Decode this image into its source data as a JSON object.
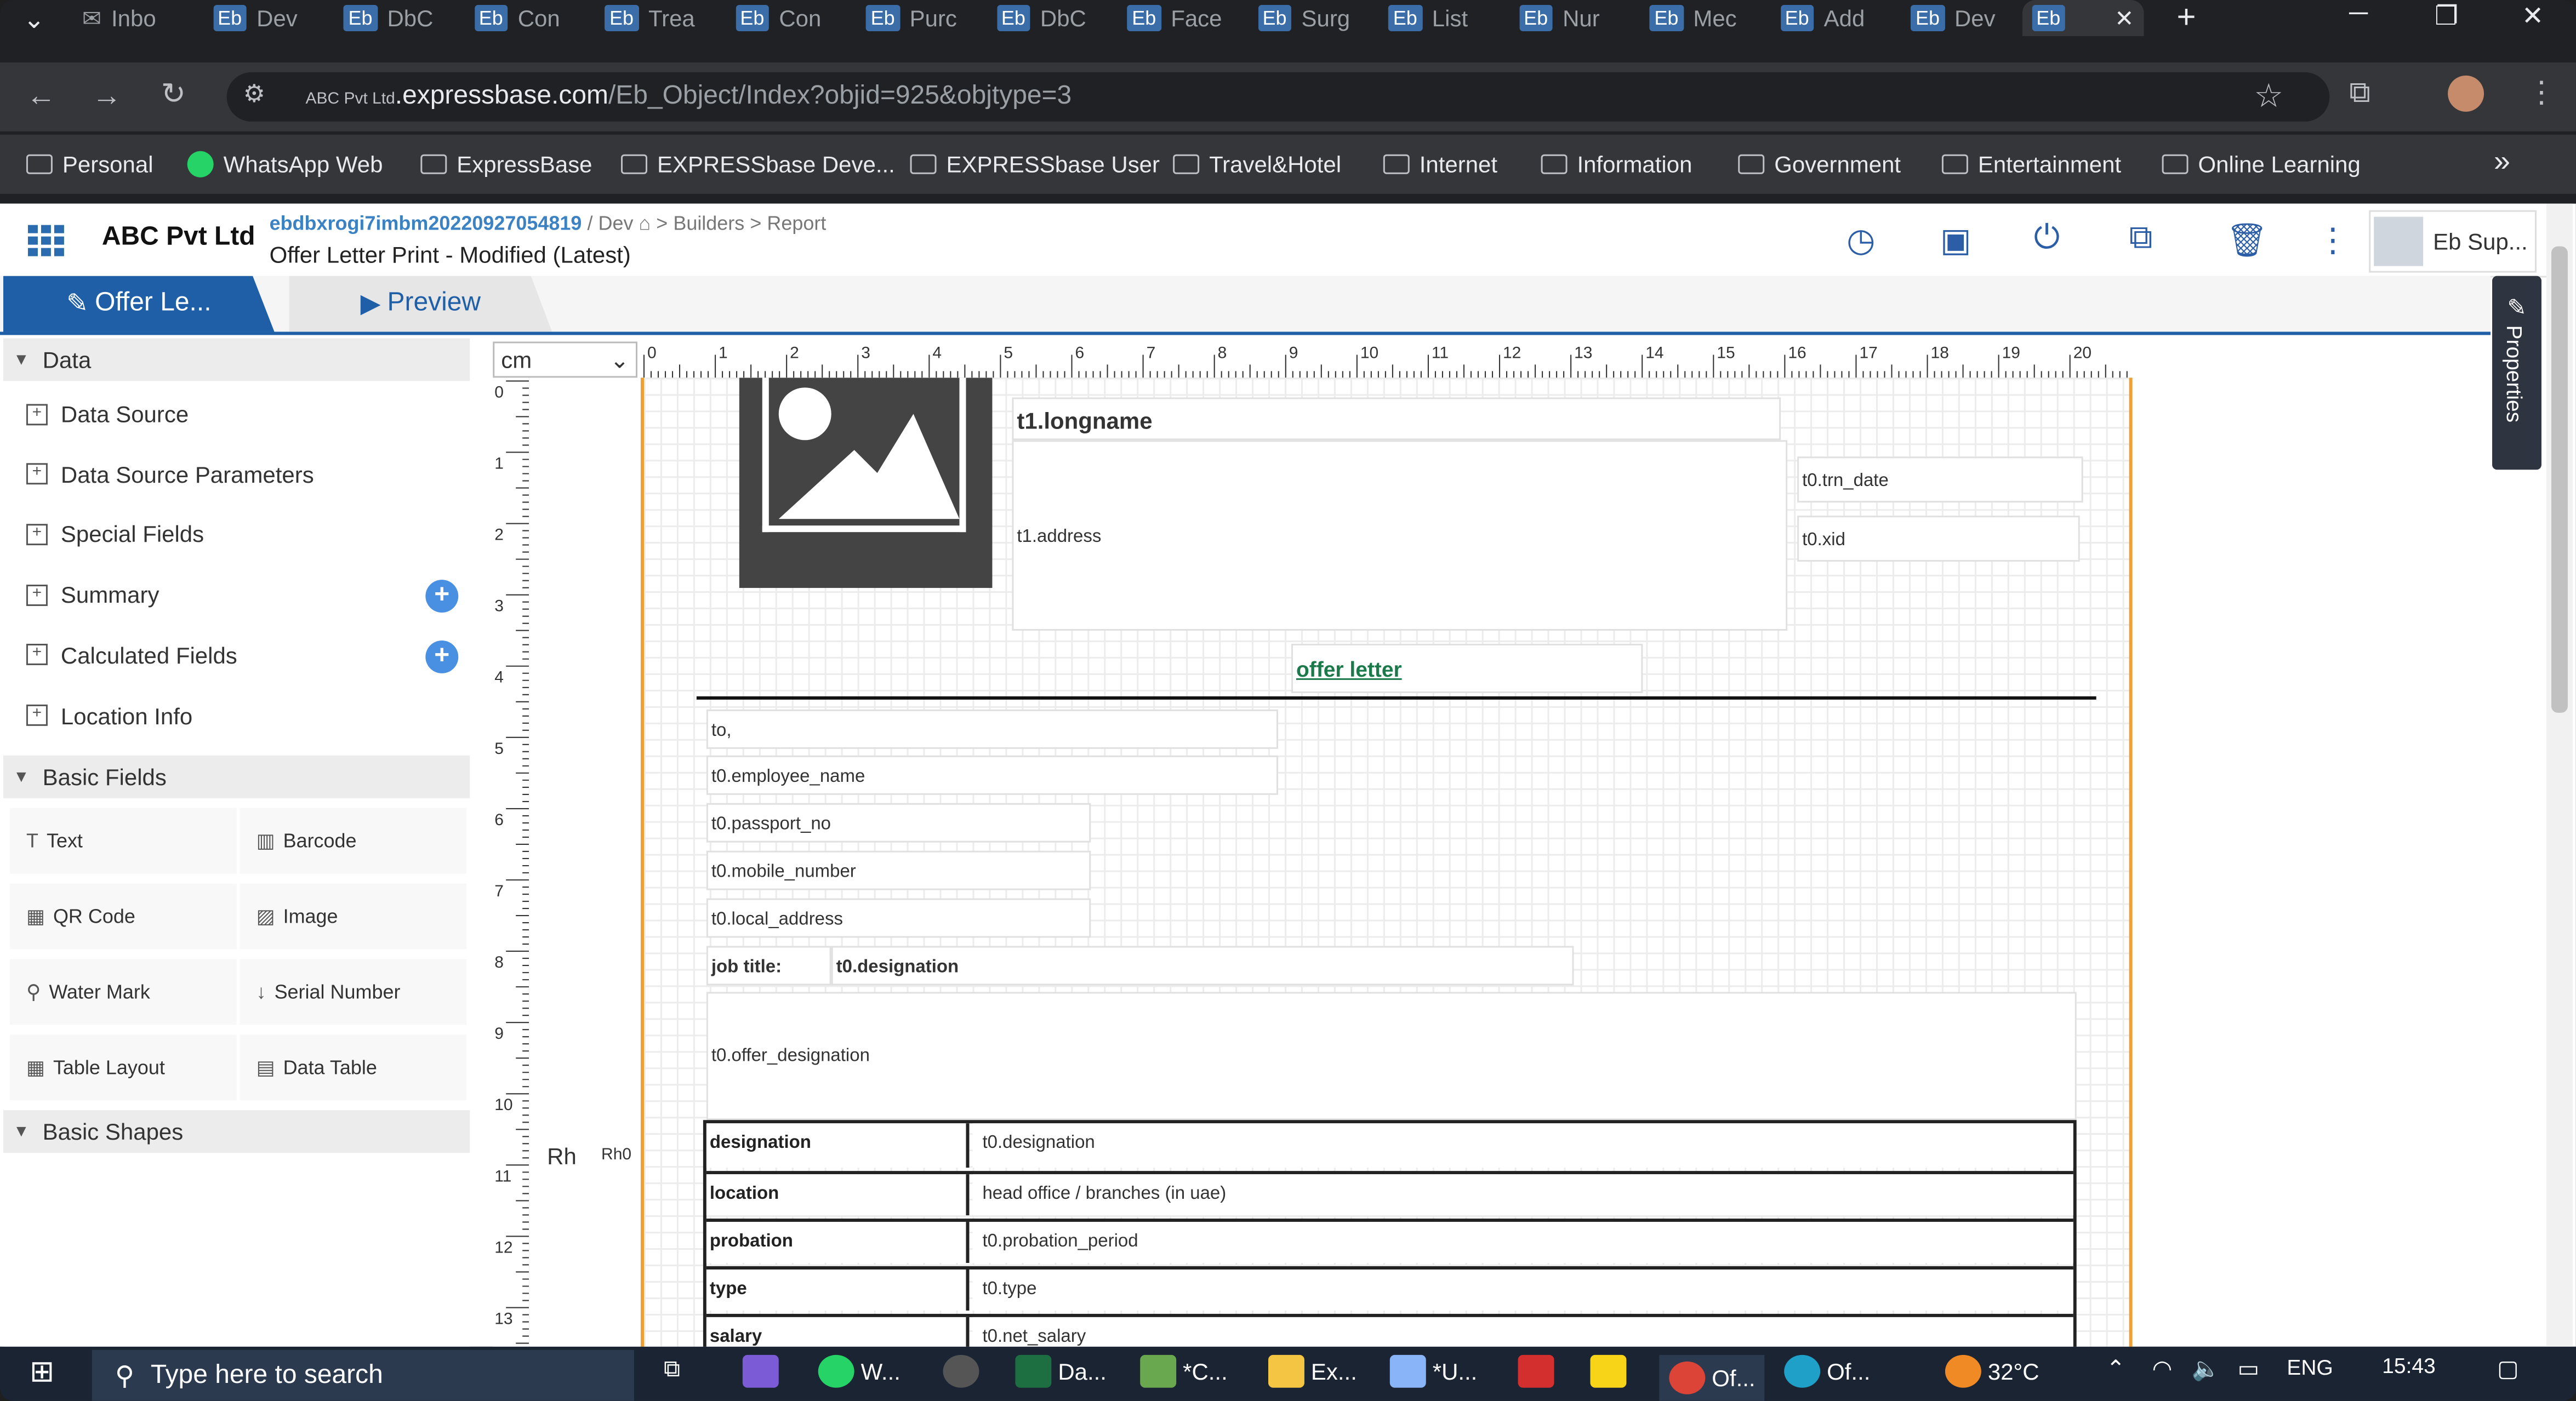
{
  "browser": {
    "tabs": [
      {
        "badge": "",
        "label": "Inbo",
        "icon": "mail-icon"
      },
      {
        "badge": "Eb",
        "label": "Dev"
      },
      {
        "badge": "Eb",
        "label": "DbC"
      },
      {
        "badge": "Eb",
        "label": "Con"
      },
      {
        "badge": "Eb",
        "label": "Trea"
      },
      {
        "badge": "Eb",
        "label": "Con"
      },
      {
        "badge": "Eb",
        "label": "Purc"
      },
      {
        "badge": "Eb",
        "label": "DbC"
      },
      {
        "badge": "Eb",
        "label": "Face"
      },
      {
        "badge": "Eb",
        "label": "Surg"
      },
      {
        "badge": "Eb",
        "label": "List"
      },
      {
        "badge": "Eb",
        "label": "Nur"
      },
      {
        "badge": "Eb",
        "label": "Mec"
      },
      {
        "badge": "Eb",
        "label": "Add"
      },
      {
        "badge": "Eb",
        "label": "Dev"
      },
      {
        "badge": "Eb",
        "label": ""
      }
    ],
    "new_tab_glyph": "+",
    "close_tab_glyph": "✕",
    "url_prefix_small": "ABC Pvt Ltd",
    "url_domain": ".expressbase.com",
    "url_path": "/Eb_Object/Index?objid=925&objtype=3",
    "bookmarks": [
      {
        "label": "Personal",
        "icon": "folder-icon"
      },
      {
        "label": "WhatsApp Web",
        "icon": "whatsapp-icon"
      },
      {
        "label": "ExpressBase",
        "icon": "folder-icon"
      },
      {
        "label": "EXPRESSbase Deve...",
        "icon": "folder-icon"
      },
      {
        "label": "EXPRESSbase User",
        "icon": "folder-icon"
      },
      {
        "label": "Travel&Hotel",
        "icon": "folder-icon"
      },
      {
        "label": "Internet",
        "icon": "folder-icon"
      },
      {
        "label": "Information",
        "icon": "folder-icon"
      },
      {
        "label": "Government",
        "icon": "folder-icon"
      },
      {
        "label": "Entertainment",
        "icon": "folder-icon"
      },
      {
        "label": "Online Learning",
        "icon": "folder-icon"
      }
    ],
    "more_bookmarks_glyph": "»"
  },
  "app": {
    "company": "ABC Pvt Ltd",
    "breadcrumb": {
      "object_id": "ebdbxrogi7imbm20220927054819",
      "sep": "/",
      "env": "Dev",
      "builders": "Builders",
      "report": "Report",
      "arrow": ">"
    },
    "page_title": "Offer Letter Print - Modified (Latest)",
    "user_name": "Eb Sup...",
    "tabs": {
      "design": "Offer Le...",
      "preview": "Preview"
    },
    "properties_tab": "Properties"
  },
  "sidebar": {
    "data_section": "Data",
    "data_items": [
      "Data Source",
      "Data Source Parameters",
      "Special Fields",
      "Summary",
      "Calculated Fields",
      "Location Info"
    ],
    "basic_fields_section": "Basic Fields",
    "tools": [
      {
        "label": "Text",
        "icon": "text-icon"
      },
      {
        "label": "Barcode",
        "icon": "barcode-icon"
      },
      {
        "label": "QR Code",
        "icon": "qrcode-icon"
      },
      {
        "label": "Image",
        "icon": "image-icon"
      },
      {
        "label": "Water Mark",
        "icon": "map-pin-icon"
      },
      {
        "label": "Serial Number",
        "icon": "sort-numeric-icon"
      },
      {
        "label": "Table Layout",
        "icon": "table-layout-icon"
      },
      {
        "label": "Data Table",
        "icon": "data-table-icon"
      }
    ],
    "basic_shapes_section": "Basic Shapes"
  },
  "designer": {
    "unit": "cm",
    "margin_labels": {
      "rh": "Rh",
      "rh0": "Rh0"
    },
    "fields": {
      "longname": "t1.longname",
      "address": "t1.address",
      "trn_date": "t0.trn_date",
      "xid": "t0.xid",
      "heading": "offer letter",
      "to": "to,",
      "employee_name": "t0.employee_name",
      "passport_no": "t0.passport_no",
      "mobile_number": "t0.mobile_number",
      "local_address": "t0.local_address",
      "job_title_label": "job title:",
      "job_title_value": "t0.designation",
      "offer_designation": "t0.offer_designation"
    },
    "table_rows": [
      {
        "label": "designation",
        "value": "t0.designation"
      },
      {
        "label": "location",
        "value": "head office / branches (in uae)"
      },
      {
        "label": "probation",
        "value": "t0.probation_period"
      },
      {
        "label": "type",
        "value": "t0.type"
      },
      {
        "label": "salary",
        "value": "t0.net_salary"
      }
    ]
  },
  "taskbar": {
    "search_placeholder": "Type here to search",
    "items": [
      "W...",
      "Da...",
      "*C...",
      "Ex...",
      "*U...",
      "Of...",
      "Of..."
    ],
    "weather": "32°C",
    "lang": "ENG",
    "time": "15:43"
  }
}
